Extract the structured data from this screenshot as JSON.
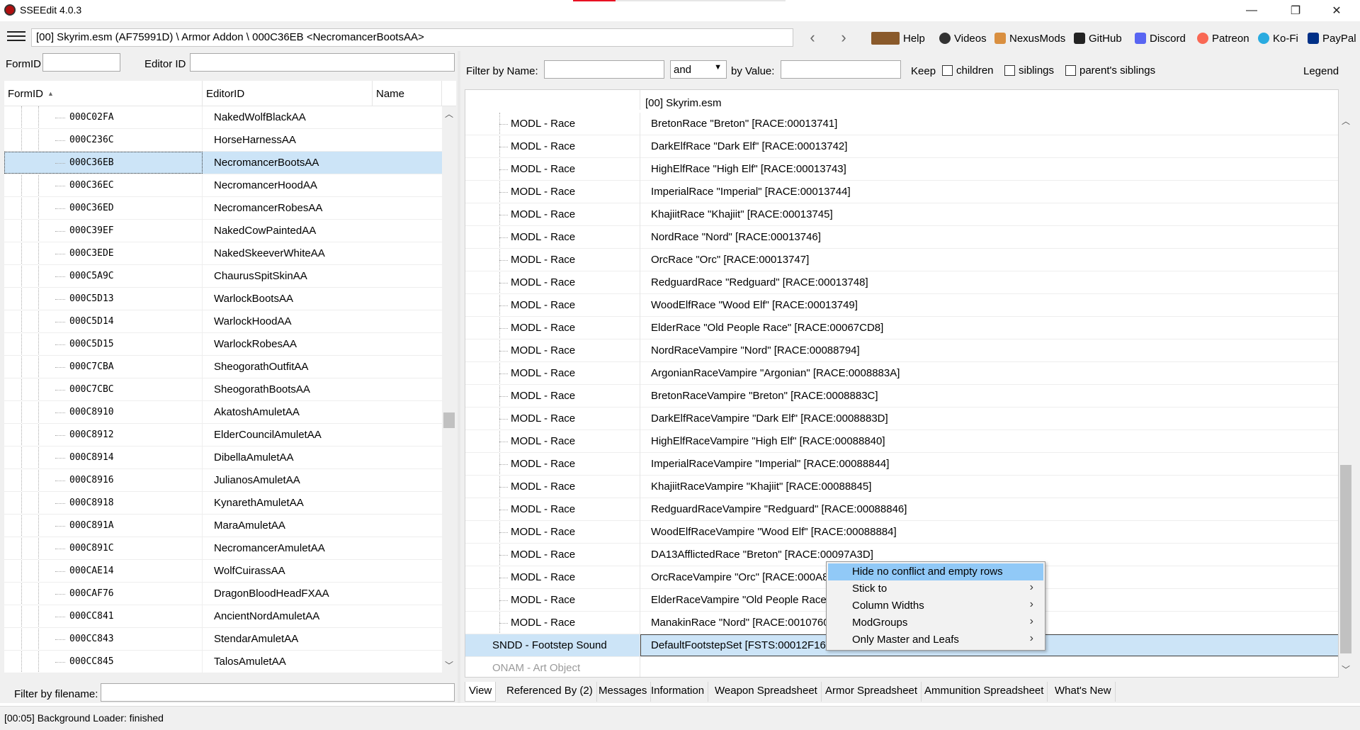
{
  "window": {
    "title": "SSEEdit 4.0.3",
    "minimize": "—",
    "maximize": "❐",
    "close": "✕"
  },
  "toolbar": {
    "path": "[00] Skyrim.esm (AF75991D) \\ Armor Addon \\ 000C36EB <NecromancerBootsAA>",
    "back": "‹",
    "forward": "›",
    "links": [
      {
        "label": "Help",
        "icon": "book-icon",
        "color": "#8a5a2b"
      },
      {
        "label": "Videos",
        "icon": "video-icon",
        "color": "#333333"
      },
      {
        "label": "NexusMods",
        "icon": "nexusmods-icon",
        "color": "#d98f40"
      },
      {
        "label": "GitHub",
        "icon": "github-icon",
        "color": "#222222"
      },
      {
        "label": "Discord",
        "icon": "discord-icon",
        "color": "#5865f2"
      },
      {
        "label": "Patreon",
        "icon": "patreon-icon",
        "color": "#f96854"
      },
      {
        "label": "Ko-Fi",
        "icon": "kofi-icon",
        "color": "#29abe0"
      },
      {
        "label": "PayPal",
        "icon": "paypal-icon",
        "color": "#003087"
      }
    ]
  },
  "left": {
    "formid_label": "FormID",
    "editorid_label": "Editor ID",
    "columns": [
      "FormID",
      "EditorID",
      "Name"
    ],
    "sort_indicator": "▲",
    "rows": [
      {
        "formid": "000C02FA",
        "editorid": "NakedWolfBlackAA"
      },
      {
        "formid": "000C236C",
        "editorid": "HorseHarnessAA"
      },
      {
        "formid": "000C36EB",
        "editorid": "NecromancerBootsAA",
        "selected": true
      },
      {
        "formid": "000C36EC",
        "editorid": "NecromancerHoodAA"
      },
      {
        "formid": "000C36ED",
        "editorid": "NecromancerRobesAA"
      },
      {
        "formid": "000C39EF",
        "editorid": "NakedCowPaintedAA"
      },
      {
        "formid": "000C3EDE",
        "editorid": "NakedSkeeverWhiteAA"
      },
      {
        "formid": "000C5A9C",
        "editorid": "ChaurusSpitSkinAA"
      },
      {
        "formid": "000C5D13",
        "editorid": "WarlockBootsAA"
      },
      {
        "formid": "000C5D14",
        "editorid": "WarlockHoodAA"
      },
      {
        "formid": "000C5D15",
        "editorid": "WarlockRobesAA"
      },
      {
        "formid": "000C7CBA",
        "editorid": "SheogorathOutfitAA"
      },
      {
        "formid": "000C7CBC",
        "editorid": "SheogorathBootsAA"
      },
      {
        "formid": "000C8910",
        "editorid": "AkatoshAmuletAA"
      },
      {
        "formid": "000C8912",
        "editorid": "ElderCouncilAmuletAA"
      },
      {
        "formid": "000C8914",
        "editorid": "DibellaAmuletAA"
      },
      {
        "formid": "000C8916",
        "editorid": "JulianosAmuletAA"
      },
      {
        "formid": "000C8918",
        "editorid": "KynarethAmuletAA"
      },
      {
        "formid": "000C891A",
        "editorid": "MaraAmuletAA"
      },
      {
        "formid": "000C891C",
        "editorid": "NecromancerAmuletAA"
      },
      {
        "formid": "000CAE14",
        "editorid": "WolfCuirassAA"
      },
      {
        "formid": "000CAF76",
        "editorid": "DragonBloodHeadFXAA"
      },
      {
        "formid": "000CC841",
        "editorid": "AncientNordAmuletAA"
      },
      {
        "formid": "000CC843",
        "editorid": "StendarAmuletAA"
      },
      {
        "formid": "000CC845",
        "editorid": "TalosAmuletAA"
      }
    ],
    "filter_filename_label": "Filter by filename:"
  },
  "right": {
    "filter_name_label": "Filter by Name:",
    "and_value": "and",
    "by_value_label": "by Value:",
    "keep_label": "Keep",
    "children_label": "children",
    "siblings_label": "siblings",
    "parents_siblings_label": "parent's siblings",
    "legend_label": "Legend",
    "column_header": "[00] Skyrim.esm",
    "rows": [
      {
        "label": "MODL - Race",
        "value": "BretonRace \"Breton\" [RACE:00013741]"
      },
      {
        "label": "MODL - Race",
        "value": "DarkElfRace \"Dark Elf\" [RACE:00013742]"
      },
      {
        "label": "MODL - Race",
        "value": "HighElfRace \"High Elf\" [RACE:00013743]"
      },
      {
        "label": "MODL - Race",
        "value": "ImperialRace \"Imperial\" [RACE:00013744]"
      },
      {
        "label": "MODL - Race",
        "value": "KhajiitRace \"Khajiit\" [RACE:00013745]"
      },
      {
        "label": "MODL - Race",
        "value": "NordRace \"Nord\" [RACE:00013746]"
      },
      {
        "label": "MODL - Race",
        "value": "OrcRace \"Orc\" [RACE:00013747]"
      },
      {
        "label": "MODL - Race",
        "value": "RedguardRace \"Redguard\" [RACE:00013748]"
      },
      {
        "label": "MODL - Race",
        "value": "WoodElfRace \"Wood Elf\" [RACE:00013749]"
      },
      {
        "label": "MODL - Race",
        "value": "ElderRace \"Old People Race\" [RACE:00067CD8]"
      },
      {
        "label": "MODL - Race",
        "value": "NordRaceVampire \"Nord\" [RACE:00088794]"
      },
      {
        "label": "MODL - Race",
        "value": "ArgonianRaceVampire \"Argonian\" [RACE:0008883A]"
      },
      {
        "label": "MODL - Race",
        "value": "BretonRaceVampire \"Breton\" [RACE:0008883C]"
      },
      {
        "label": "MODL - Race",
        "value": "DarkElfRaceVampire \"Dark Elf\" [RACE:0008883D]"
      },
      {
        "label": "MODL - Race",
        "value": "HighElfRaceVampire \"High Elf\" [RACE:00088840]"
      },
      {
        "label": "MODL - Race",
        "value": "ImperialRaceVampire \"Imperial\" [RACE:00088844]"
      },
      {
        "label": "MODL - Race",
        "value": "KhajiitRaceVampire \"Khajiit\" [RACE:00088845]"
      },
      {
        "label": "MODL - Race",
        "value": "RedguardRaceVampire \"Redguard\" [RACE:00088846]"
      },
      {
        "label": "MODL - Race",
        "value": "WoodElfRaceVampire \"Wood Elf\" [RACE:00088884]"
      },
      {
        "label": "MODL - Race",
        "value": "DA13AfflictedRace \"Breton\" [RACE:00097A3D]"
      },
      {
        "label": "MODL - Race",
        "value": "OrcRaceVampire \"Orc\" [RACE:000A82"
      },
      {
        "label": "MODL - Race",
        "value": "ElderRaceVampire \"Old People Race\""
      },
      {
        "label": "MODL - Race",
        "value": "ManakinRace \"Nord\" [RACE:0010760A"
      },
      {
        "label": "SNDD - Footstep Sound",
        "value": "DefaultFootstepSet [FSTS:00012F16]",
        "selected": true
      },
      {
        "label": "ONAM - Art Object",
        "value": "",
        "disabled": true
      }
    ],
    "tabs": [
      "View",
      "Referenced By (2)",
      "Messages",
      "Information",
      "Weapon Spreadsheet",
      "Armor Spreadsheet",
      "Ammunition Spreadsheet",
      "What's New"
    ]
  },
  "context_menu": {
    "items": [
      {
        "label": "Hide no conflict and empty rows",
        "highlighted": true
      },
      {
        "label": "Stick to",
        "submenu": "›"
      },
      {
        "label": "Column Widths",
        "submenu": "›"
      },
      {
        "label": "ModGroups",
        "submenu": "›"
      },
      {
        "label": "Only Master and Leafs",
        "submenu": "›"
      }
    ]
  },
  "status": "[00:05] Background Loader: finished"
}
